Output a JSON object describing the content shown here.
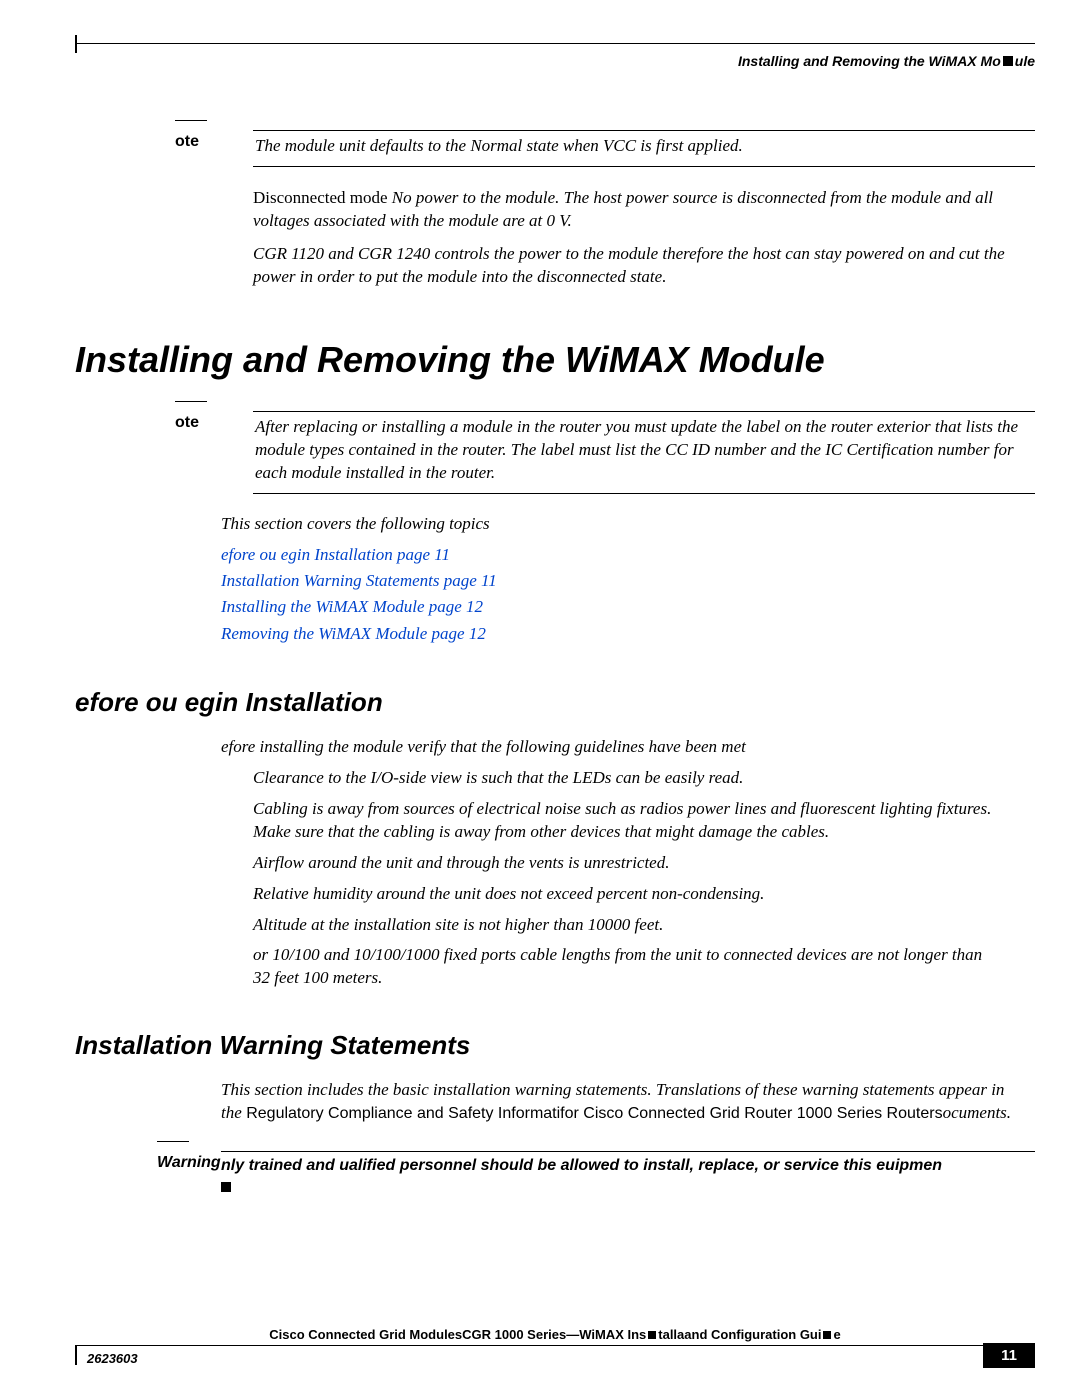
{
  "header": {
    "running_title": "Installing and Removing the WiMAX Mo",
    "running_title_suffix": "ule"
  },
  "note1": {
    "label": "ote",
    "text": "The module unit defaults to the Normal state when VCC is first applied."
  },
  "disconnected": {
    "lead": "Disconnected mode",
    "body": " No power to the module. The host power source is disconnected from the module and all voltages associated with the module are at 0 V."
  },
  "cgr_text": "CGR 1120 and CGR 1240 controls the power to the module therefore the host can stay powered on and cut the power in order to put the module into the disconnected state.",
  "h1": "Installing and Removing the WiMAX Module",
  "note2": {
    "label": "ote",
    "text": "After replacing or installing a module in the router you must update the label on the router exterior that lists the module types contained in the router. The label must list the CC ID number and the IC Certification number for each module installed in the router."
  },
  "topics_intro": "This section covers the following topics",
  "links": [
    "efore ou egin Installation page 11",
    "Installation Warning Statements page 11",
    "Installing the WiMAX Module page 12",
    "Removing the WiMAX Module page 12"
  ],
  "h2a": "efore ou egin Installation",
  "guidelines_lead": "efore installing the module verify that the following guidelines have been met",
  "guidelines": [
    "Clearance to the I/O-side view is such that the LEDs can be easily read.",
    "Cabling is away from sources of electrical noise such as radios power lines and fluorescent lighting fixtures. Make sure that the cabling is away from other devices that might damage the cables.",
    "Airflow around the unit and through the vents is unrestricted.",
    "Relative humidity around the unit does not exceed  percent non-condensing.",
    "Altitude at the installation site is not higher than 10000 feet.",
    "or 10/100 and 10/100/1000 fixed ports cable lengths from the unit to connected devices are not longer than 32 feet 100 meters."
  ],
  "h2b": "Installation Warning Statements",
  "warn_para": {
    "pre": "This section includes the basic installation warning statements. Translations of these warning statements appear in the",
    "reg1": " Regulatory Compliance and Safety Informati",
    "mid": "for",
    "reg2": " Cisco Connected Grid Router 1000 Series Routers",
    "post": "ocuments."
  },
  "warning": {
    "label": "Warning",
    "text": "nly trained and ualified personnel should be allowed to install, replace, or service this euipmen"
  },
  "footer": {
    "title_left": "Cisco Connected Grid Modules",
    "title_mid": "CGR 1000 Series—WiMAX Ins",
    "title_mid2": "tallaand Configuration Gui",
    "title_end": "e",
    "docnum": "2623603",
    "pagenum": "11"
  }
}
